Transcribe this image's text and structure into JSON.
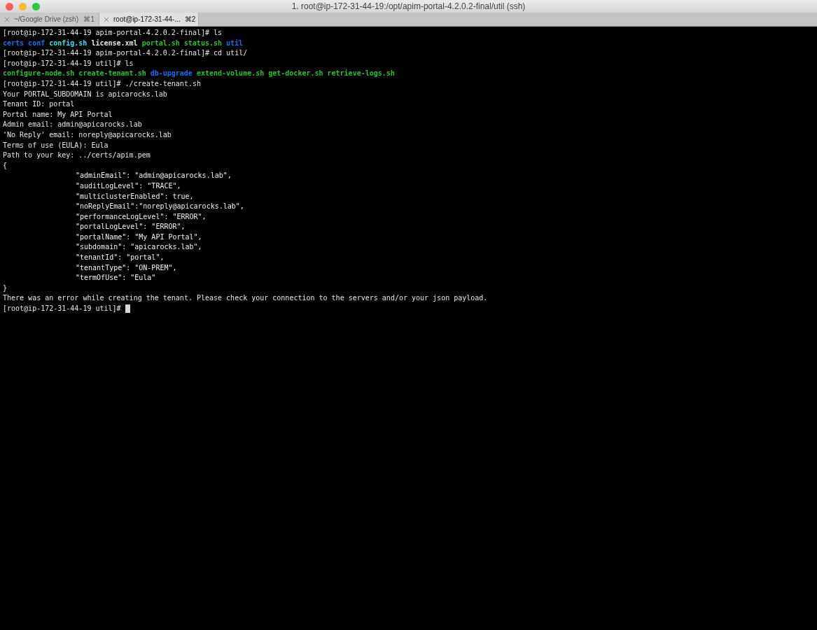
{
  "window": {
    "title": "1. root@ip-172-31-44-19:/opt/apim-portal-4.2.0.2-final/util (ssh)"
  },
  "tabs": [
    {
      "label": "~/Google Drive (zsh)",
      "shortcut": "⌘1",
      "selected": false
    },
    {
      "label": "root@ip-172-31-44-...",
      "shortcut": "⌘2",
      "selected": true
    }
  ],
  "terminal": {
    "lines": [
      {
        "text": "[root@ip-172-31-44-19 apim-portal-4.2.0.2-final]# ls"
      },
      {
        "items": [
          {
            "text": "certs",
            "color": "#1a6cf0"
          },
          {
            "text": "conf",
            "color": "#1a6cf0"
          },
          {
            "text": "config.sh",
            "color": "#3fe0e8"
          },
          {
            "text": "license.xml",
            "color": "#e6e6e6"
          },
          {
            "text": "portal.sh",
            "color": "#2fbf2f"
          },
          {
            "text": "status.sh",
            "color": "#2fbf2f"
          },
          {
            "text": "util",
            "color": "#1a6cf0"
          }
        ]
      },
      {
        "text": "[root@ip-172-31-44-19 apim-portal-4.2.0.2-final]# cd util/"
      },
      {
        "text": "[root@ip-172-31-44-19 util]# ls"
      },
      {
        "items": [
          {
            "text": "configure-node.sh",
            "color": "#2fbf2f"
          },
          {
            "text": "create-tenant.sh",
            "color": "#2fbf2f"
          },
          {
            "text": "db-upgrade",
            "color": "#1a6cf0"
          },
          {
            "text": "extend-volume.sh",
            "color": "#2fbf2f"
          },
          {
            "text": "get-docker.sh",
            "color": "#2fbf2f"
          },
          {
            "text": "retrieve-logs.sh",
            "color": "#2fbf2f"
          }
        ]
      },
      {
        "text": "[root@ip-172-31-44-19 util]# ./create-tenant.sh"
      },
      {
        "text": "Your PORTAL_SUBDOMAIN is apicarocks.lab"
      },
      {
        "text": "Tenant ID: portal"
      },
      {
        "text": "Portal name: My API Portal"
      },
      {
        "text": "Admin email: admin@apicarocks.lab"
      },
      {
        "text": "'No Reply' email: noreply@apicarocks.lab"
      },
      {
        "text": "Terms of use (EULA): Eula"
      },
      {
        "text": "Path to your key: ../certs/apim.pem"
      },
      {
        "text": "{"
      },
      {
        "text": "\"adminEmail\": \"admin@apicarocks.lab\",",
        "indented": true
      },
      {
        "text": "\"auditLogLevel\": \"TRACE\",",
        "indented": true
      },
      {
        "text": "\"multiclusterEnabled\": true,",
        "indented": true
      },
      {
        "text": "\"noReplyEmail\":\"noreply@apicarocks.lab\",",
        "indented": true
      },
      {
        "text": "\"performanceLogLevel\": \"ERROR\",",
        "indented": true
      },
      {
        "text": "\"portalLogLevel\": \"ERROR\",",
        "indented": true
      },
      {
        "text": "\"portalName\": \"My API Portal\",",
        "indented": true
      },
      {
        "text": "\"subdomain\": \"apicarocks.lab\",",
        "indented": true
      },
      {
        "text": "\"tenantId\": \"portal\",",
        "indented": true
      },
      {
        "text": "\"tenantType\": \"ON-PREM\",",
        "indented": true
      },
      {
        "text": "\"termOfUse\": \"Eula\"",
        "indented": true
      },
      {
        "text": "}"
      },
      {
        "text": "There was an error while creating the tenant. Please check your connection to the servers and/or your json payload."
      },
      {
        "text": "[root@ip-172-31-44-19 util]#",
        "cursor": true
      }
    ]
  }
}
